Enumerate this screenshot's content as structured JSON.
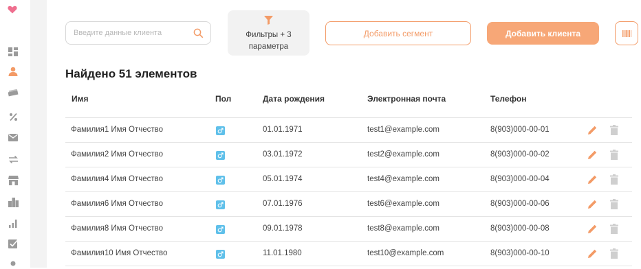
{
  "search": {
    "placeholder": "Введите данные клиента"
  },
  "toolbar": {
    "filters_label": "Фильтры + 3 параметра",
    "add_segment_label": "Добавить сегмент",
    "add_client_label": "Добавить клиента"
  },
  "results": {
    "found_text": "Найдено 51 элементов"
  },
  "table": {
    "columns": [
      "Имя",
      "Пол",
      "Дата рождения",
      "Электронная почта",
      "Телефон"
    ],
    "rows": [
      {
        "name": "Фамилия1 Имя Отчество",
        "gender": "male",
        "birth_date": "01.01.1971",
        "email": "test1@example.com",
        "phone": "8(903)000-00-01"
      },
      {
        "name": "Фамилия2 Имя Отчество",
        "gender": "male",
        "birth_date": "03.01.1972",
        "email": "test2@example.com",
        "phone": "8(903)000-00-02"
      },
      {
        "name": "Фамилия4 Имя Отчество",
        "gender": "male",
        "birth_date": "05.01.1974",
        "email": "test4@example.com",
        "phone": "8(903)000-00-04"
      },
      {
        "name": "Фамилия6 Имя Отчество",
        "gender": "male",
        "birth_date": "07.01.1976",
        "email": "test6@example.com",
        "phone": "8(903)000-00-06"
      },
      {
        "name": "Фамилия8 Имя Отчество",
        "gender": "male",
        "birth_date": "09.01.1978",
        "email": "test8@example.com",
        "phone": "8(903)000-00-08"
      },
      {
        "name": "Фамилия10 Имя Отчество",
        "gender": "male",
        "birth_date": "11.01.1980",
        "email": "test10@example.com",
        "phone": "8(903)000-00-10"
      }
    ]
  },
  "colors": {
    "accent": "#f39b67",
    "accent_fill": "#f7a777",
    "gender_male": "#5fc0ea",
    "active_nav": "#f39b67",
    "logo": "#ef6f8f"
  },
  "sidebar": {
    "items": [
      {
        "icon": "dashboard-icon",
        "active": false
      },
      {
        "icon": "user-icon",
        "active": true
      },
      {
        "icon": "cards-icon",
        "active": false
      },
      {
        "icon": "percent-icon",
        "active": false
      },
      {
        "icon": "mail-icon",
        "active": false
      },
      {
        "icon": "exchange-icon",
        "active": false
      },
      {
        "icon": "store-icon",
        "active": false
      },
      {
        "icon": "buildings-icon",
        "active": false
      },
      {
        "icon": "bar-chart-icon",
        "active": false
      },
      {
        "icon": "checklist-icon",
        "active": false
      }
    ]
  }
}
